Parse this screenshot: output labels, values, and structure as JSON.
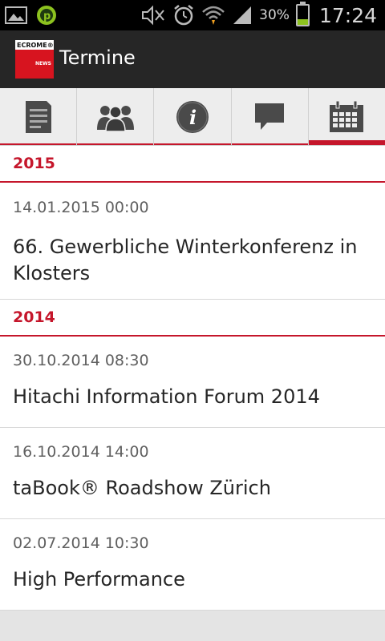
{
  "status_bar": {
    "battery_text": "30%",
    "battery_level": 0.3,
    "time": "17:24",
    "icons": [
      "picture-icon",
      "p-app-icon",
      "mute-icon",
      "alarm-icon",
      "wifi-icon",
      "signal-icon"
    ]
  },
  "app_bar": {
    "logo_text": "ECROME®",
    "logo_subtext": "NEWS",
    "title": "Termine"
  },
  "tabs": [
    {
      "icon": "news-icon",
      "active": false
    },
    {
      "icon": "people-icon",
      "active": false
    },
    {
      "icon": "info-icon",
      "active": false
    },
    {
      "icon": "chat-icon",
      "active": false
    },
    {
      "icon": "calendar-icon",
      "active": true
    }
  ],
  "colors": {
    "accent": "#c5162b",
    "action_bar": "#262626",
    "tab_bar": "#ededed"
  },
  "sections": [
    {
      "year": "2015",
      "events": [
        {
          "date": "14.01.2015 00:00",
          "title": "66. Gewerbliche Winterkonferenz in Klosters"
        }
      ]
    },
    {
      "year": "2014",
      "events": [
        {
          "date": "30.10.2014 08:30",
          "title": "Hitachi Information Forum 2014"
        },
        {
          "date": "16.10.2014 14:00",
          "title": "taBook® Roadshow Zürich"
        },
        {
          "date": "02.07.2014 10:30",
          "title": "High Performance"
        }
      ]
    }
  ]
}
